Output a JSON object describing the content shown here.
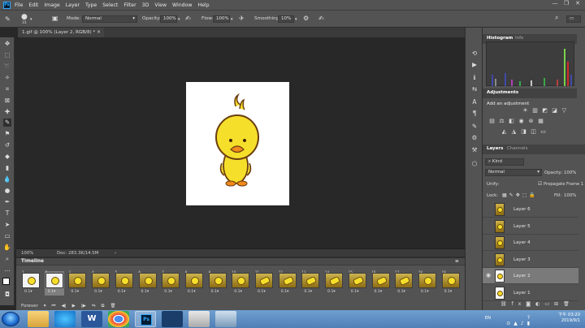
{
  "app": {
    "logo": "Ps"
  },
  "menu": {
    "items": [
      "File",
      "Edit",
      "Image",
      "Layer",
      "Type",
      "Select",
      "Filter",
      "3D",
      "View",
      "Window",
      "Help"
    ]
  },
  "window_controls": [
    "—",
    "❐",
    "✕"
  ],
  "options": {
    "brush_size": "31",
    "mode_label": "Mode:",
    "mode_value": "Normal",
    "opacity_label": "Opacity:",
    "opacity_value": "100%",
    "flow_label": "Flow:",
    "flow_value": "100%",
    "smoothing_label": "Smoothing:",
    "smoothing_value": "10%"
  },
  "document": {
    "tab_title": "1.gif @ 100% (Layer 2, RGB/8) *",
    "close": "×"
  },
  "status": {
    "zoom": "100%",
    "doc_info": "Doc: 283.3K/14.5M"
  },
  "timeline": {
    "title": "Timeline",
    "frames": [
      {
        "num": "1",
        "delay": "0.1",
        "thumb": "white"
      },
      {
        "num": "2",
        "delay": "0.1",
        "thumb": "white",
        "selected": true
      },
      {
        "num": "3",
        "delay": "0.1",
        "thumb": "round"
      },
      {
        "num": "4",
        "delay": "0.1",
        "thumb": "round"
      },
      {
        "num": "5",
        "delay": "0.1",
        "thumb": "round"
      },
      {
        "num": "6",
        "delay": "0.1",
        "thumb": "round"
      },
      {
        "num": "7",
        "delay": "0.1",
        "thumb": "round"
      },
      {
        "num": "8",
        "delay": "0.1",
        "thumb": "round"
      },
      {
        "num": "9",
        "delay": "0.1",
        "thumb": "round"
      },
      {
        "num": "10",
        "delay": "0.1",
        "thumb": "round"
      },
      {
        "num": "11",
        "delay": "0.1",
        "thumb": "flat"
      },
      {
        "num": "12",
        "delay": "0.1",
        "thumb": "flat"
      },
      {
        "num": "13",
        "delay": "0.1",
        "thumb": "flat"
      },
      {
        "num": "14",
        "delay": "0.1",
        "thumb": "flat"
      },
      {
        "num": "15",
        "delay": "0.1",
        "thumb": "flat"
      },
      {
        "num": "16",
        "delay": "0.1",
        "thumb": "flat"
      },
      {
        "num": "17",
        "delay": "0.1",
        "thumb": "flat"
      },
      {
        "num": "18",
        "delay": "0.1",
        "thumb": "round"
      },
      {
        "num": "19",
        "delay": "0.1",
        "thumb": "round"
      }
    ],
    "loop": "Forever"
  },
  "panels": {
    "histogram_tab": "Histogram",
    "info_tab": "Info",
    "adjustments_tab": "Adjustments",
    "add_adjustment": "Add an adjustment",
    "layers_tab": "Layers",
    "channels_tab": "Channels",
    "kind_label": "Kind",
    "blend_mode": "Normal",
    "opacity_label": "Opacity:",
    "opacity_value": "100%",
    "unify_label": "Unify:",
    "propagate_label": "Propagate Frame 1",
    "lock_label": "Lock:",
    "fill_label": "Fill:",
    "fill_value": "100%"
  },
  "layers": [
    {
      "name": "Layer 6",
      "visible": false,
      "thumb": "round"
    },
    {
      "name": "Layer 5",
      "visible": false,
      "thumb": "round"
    },
    {
      "name": "Layer 4",
      "visible": false,
      "thumb": "round"
    },
    {
      "name": "Layer 3",
      "visible": false,
      "thumb": "round"
    },
    {
      "name": "Layer 2",
      "visible": true,
      "thumb": "white",
      "selected": true
    },
    {
      "name": "Layer 1",
      "visible": false,
      "thumb": "white"
    }
  ],
  "taskbar": {
    "lang": "EN",
    "time": "下午 03:20",
    "date": "2019/9/1"
  },
  "colors": {
    "ui_dark": "#535353",
    "canvas_bg": "#282828",
    "accent": "#31a8ff",
    "duck_yellow": "#f6df2a",
    "duck_beak": "#f08a1c"
  }
}
